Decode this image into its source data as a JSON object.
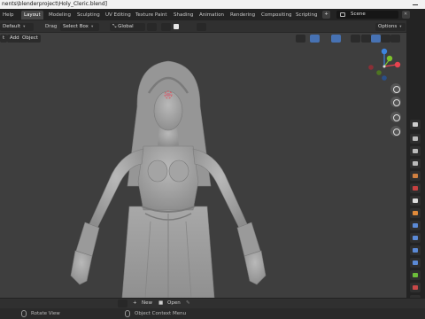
{
  "window": {
    "title": "nents\\blenderproject\\Holy_Cleric.blend]"
  },
  "topbar": {
    "menu_help": "Help",
    "tabs": [
      "Layout",
      "Modeling",
      "Sculpting",
      "UV Editing",
      "Texture Paint",
      "Shading",
      "Animation",
      "Rendering",
      "Compositing",
      "Scripting"
    ],
    "active_tab": "Layout",
    "add_tab": "+",
    "scene": "Scene"
  },
  "header": {
    "orientation_value": "Default",
    "drag_label": "Drag",
    "drag_value": "Select Box",
    "transform_orientation": "Global",
    "options_label": "Options"
  },
  "viewport": {
    "menus": [
      "t",
      "Add",
      "Object"
    ],
    "gizmo_axes": {
      "x": "X",
      "y": "Y",
      "z": "Z"
    },
    "model": "sculpted female cleric character in A-pose, hooded veil, ornate armored dress"
  },
  "timeline": {
    "new_label": "New",
    "open_label": "Open"
  },
  "status": {
    "rotate_view": "Rotate View",
    "context_menu": "Object Context Menu"
  },
  "colors": {
    "accent": "#4772b3",
    "x_axis": "#e8434f",
    "y_axis": "#7dc12c",
    "z_axis": "#3d85e0"
  }
}
